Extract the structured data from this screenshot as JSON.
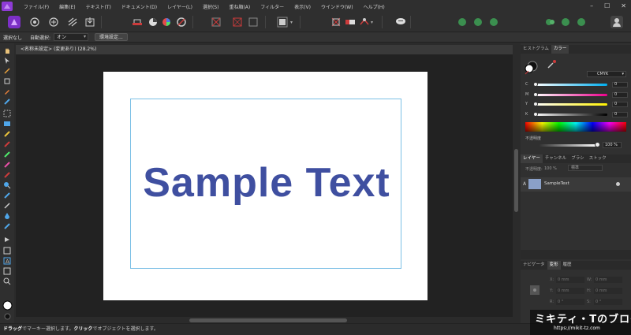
{
  "menubar": {
    "items": [
      "ファイル(F)",
      "編集(E)",
      "テキスト(T)",
      "ドキュメント(D)",
      "レイヤー(L)",
      "選択(S)",
      "重ね順(A)",
      "フィルター",
      "表示(V)",
      "ウインドウ(W)",
      "ヘルプ(H)"
    ],
    "window_controls": [
      "–",
      "☐",
      "✕"
    ]
  },
  "contextbar": {
    "selection_label": "選択なし",
    "auto_select_label": "自動選択:",
    "auto_select_value": "オン",
    "prefs_button": "環境設定..."
  },
  "document": {
    "tab_title": "<名称未設定> (変更あり) (28.2%)",
    "text": "Sample Text",
    "text_color": "#3f4fa0"
  },
  "right_panel": {
    "top_tabs": [
      "ヒストグラム",
      "カラー"
    ],
    "color_model": "CMYK",
    "channels": [
      {
        "key": "C",
        "value": "0"
      },
      {
        "key": "M",
        "value": "0"
      },
      {
        "key": "Y",
        "value": "0"
      },
      {
        "key": "K",
        "value": "0"
      }
    ],
    "opacity_label": "不透明度",
    "opacity_value": "100 %",
    "layer_tabs": [
      "レイヤー",
      "チャンネル",
      "ブラシ",
      "ストック"
    ],
    "layer_opacity_label": "不透明度:",
    "layer_opacity_value": "100 %",
    "blend_mode": "標準",
    "layers": [
      {
        "name": "SampleText"
      }
    ],
    "bottom_tabs": [
      "ナビゲータ",
      "変形",
      "履歴"
    ],
    "transform": {
      "x": "0 mm",
      "y": "0 mm",
      "w": "0 mm",
      "h": "0 mm",
      "r": "0 °",
      "s": "0 °",
      "x_label": "X:",
      "y_label": "Y:",
      "w_label": "W:",
      "h_label": "H:",
      "r_label": "R:",
      "s_label": "S:"
    }
  },
  "statusbar": {
    "drag": "ドラッグ",
    "drag_text": "でマーキー選択します。",
    "click": "クリック",
    "click_text": "でオブジェクトを選択します。"
  },
  "watermark": {
    "title": "ミキティ・Tのブログ",
    "url": "https://mikit-tz.com"
  }
}
